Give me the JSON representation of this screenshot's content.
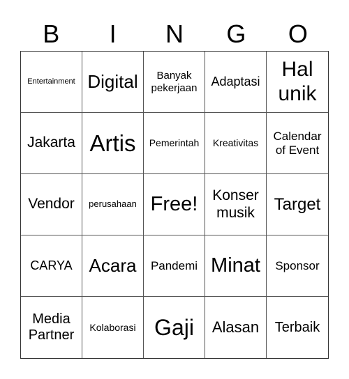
{
  "header": {
    "letters": [
      "B",
      "I",
      "N",
      "G",
      "O"
    ]
  },
  "cells": [
    [
      "Entertainment",
      "Digital",
      "Banyak pekerjaan",
      "Adaptasi",
      "Hal unik"
    ],
    [
      "Jakarta",
      "Artis",
      "Pemerintah",
      "Kreativitas",
      "Calendar of Event"
    ],
    [
      "Vendor",
      "perusahaan",
      "Free!",
      "Konser musik",
      "Target"
    ],
    [
      "CARYA",
      "Acara",
      "Pandemi",
      "Minat",
      "Sponsor"
    ],
    [
      "Media Partner",
      "Kolaborasi",
      "Gaji",
      "Alasan",
      "Terbaik"
    ]
  ]
}
